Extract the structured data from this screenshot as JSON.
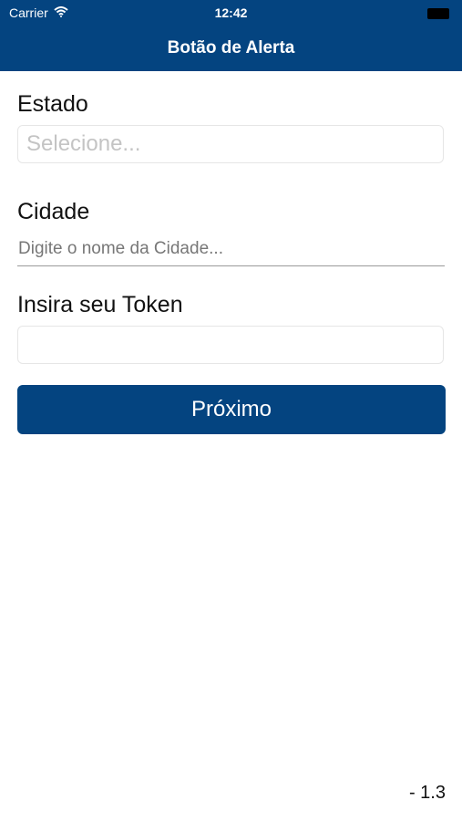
{
  "status_bar": {
    "carrier": "Carrier",
    "time": "12:42"
  },
  "nav": {
    "title": "Botão de Alerta"
  },
  "form": {
    "estado": {
      "label": "Estado",
      "placeholder": "Selecione..."
    },
    "cidade": {
      "label": "Cidade",
      "placeholder": "Digite o nome da Cidade..."
    },
    "token": {
      "label": "Insira seu Token",
      "value": ""
    },
    "next_label": "Próximo"
  },
  "footer": {
    "version": "- 1.3"
  },
  "colors": {
    "primary": "#044480",
    "background": "#ffffff"
  }
}
